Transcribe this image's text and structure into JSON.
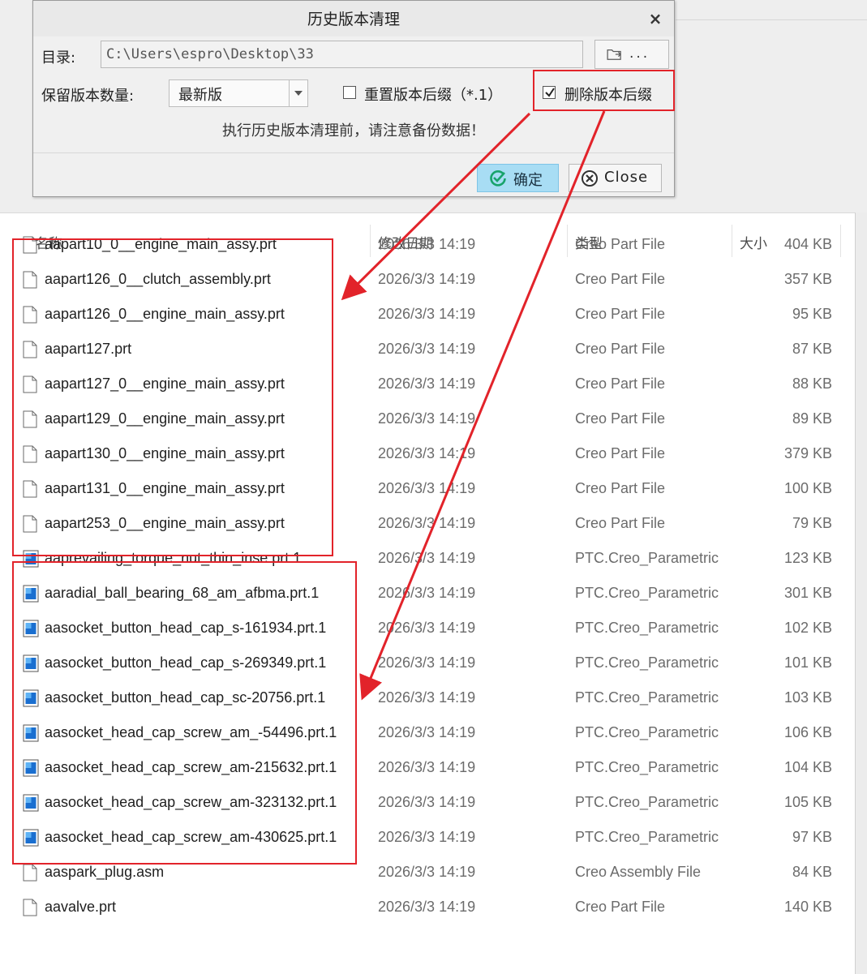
{
  "dialog": {
    "title": "历史版本清理",
    "close_glyph": "×",
    "dir_label": "目录:",
    "dir_value": "C:\\Users\\espro\\Desktop\\33",
    "browse_label": "...",
    "keep_label": "保留版本数量:",
    "keep_value": "最新版",
    "reset_suffix_label": "重置版本后缀（*.1）",
    "reset_suffix_checked": false,
    "delete_suffix_label": "删除版本后缀",
    "delete_suffix_checked": true,
    "warning": "执行历史版本清理前，请注意备份数据！",
    "ok_label": "确定",
    "close_label": "Close"
  },
  "explorer": {
    "columns": {
      "name": "名称",
      "date": "修改日期",
      "type": "类型",
      "size": "大小"
    },
    "files": [
      {
        "name": "aapart10_0__engine_main_assy.prt",
        "date": "2026/3/3 14:19",
        "type": "Creo Part File",
        "size": "404 KB",
        "icon": "blank-file-icon"
      },
      {
        "name": "aapart126_0__clutch_assembly.prt",
        "date": "2026/3/3 14:19",
        "type": "Creo Part File",
        "size": "357 KB",
        "icon": "blank-file-icon"
      },
      {
        "name": "aapart126_0__engine_main_assy.prt",
        "date": "2026/3/3 14:19",
        "type": "Creo Part File",
        "size": "95 KB",
        "icon": "blank-file-icon"
      },
      {
        "name": "aapart127.prt",
        "date": "2026/3/3 14:19",
        "type": "Creo Part File",
        "size": "87 KB",
        "icon": "blank-file-icon"
      },
      {
        "name": "aapart127_0__engine_main_assy.prt",
        "date": "2026/3/3 14:19",
        "type": "Creo Part File",
        "size": "88 KB",
        "icon": "blank-file-icon"
      },
      {
        "name": "aapart129_0__engine_main_assy.prt",
        "date": "2026/3/3 14:19",
        "type": "Creo Part File",
        "size": "89 KB",
        "icon": "blank-file-icon"
      },
      {
        "name": "aapart130_0__engine_main_assy.prt",
        "date": "2026/3/3 14:19",
        "type": "Creo Part File",
        "size": "379 KB",
        "icon": "blank-file-icon"
      },
      {
        "name": "aapart131_0__engine_main_assy.prt",
        "date": "2026/3/3 14:19",
        "type": "Creo Part File",
        "size": "100 KB",
        "icon": "blank-file-icon"
      },
      {
        "name": "aapart253_0__engine_main_assy.prt",
        "date": "2026/3/3 14:19",
        "type": "Creo Part File",
        "size": "79 KB",
        "icon": "blank-file-icon"
      },
      {
        "name": "aaprevailing_torque_nut_thin_inse.prt.1",
        "date": "2026/3/3 14:19",
        "type": "PTC.Creo_Parametric",
        "size": "123 KB",
        "icon": "creo-file-icon"
      },
      {
        "name": "aaradial_ball_bearing_68_am_afbma.prt.1",
        "date": "2026/3/3 14:19",
        "type": "PTC.Creo_Parametric",
        "size": "301 KB",
        "icon": "creo-file-icon"
      },
      {
        "name": "aasocket_button_head_cap_s-161934.prt.1",
        "date": "2026/3/3 14:19",
        "type": "PTC.Creo_Parametric",
        "size": "102 KB",
        "icon": "creo-file-icon"
      },
      {
        "name": "aasocket_button_head_cap_s-269349.prt.1",
        "date": "2026/3/3 14:19",
        "type": "PTC.Creo_Parametric",
        "size": "101 KB",
        "icon": "creo-file-icon"
      },
      {
        "name": "aasocket_button_head_cap_sc-20756.prt.1",
        "date": "2026/3/3 14:19",
        "type": "PTC.Creo_Parametric",
        "size": "103 KB",
        "icon": "creo-file-icon"
      },
      {
        "name": "aasocket_head_cap_screw_am_-54496.prt.1",
        "date": "2026/3/3 14:19",
        "type": "PTC.Creo_Parametric",
        "size": "106 KB",
        "icon": "creo-file-icon"
      },
      {
        "name": "aasocket_head_cap_screw_am-215632.prt.1",
        "date": "2026/3/3 14:19",
        "type": "PTC.Creo_Parametric",
        "size": "104 KB",
        "icon": "creo-file-icon"
      },
      {
        "name": "aasocket_head_cap_screw_am-323132.prt.1",
        "date": "2026/3/3 14:19",
        "type": "PTC.Creo_Parametric",
        "size": "105 KB",
        "icon": "creo-file-icon"
      },
      {
        "name": "aasocket_head_cap_screw_am-430625.prt.1",
        "date": "2026/3/3 14:19",
        "type": "PTC.Creo_Parametric",
        "size": "97 KB",
        "icon": "creo-file-icon"
      },
      {
        "name": "aaspark_plug.asm",
        "date": "2026/3/3 14:19",
        "type": "Creo Assembly File",
        "size": "84 KB",
        "icon": "blank-file-icon"
      },
      {
        "name": "aavalve.prt",
        "date": "2026/3/3 14:19",
        "type": "Creo Part File",
        "size": "140 KB",
        "icon": "blank-file-icon"
      }
    ]
  },
  "colors": {
    "annotation_red": "#e2232a",
    "ok_button": "#a8ddf4",
    "creo_blue": "#1a6fd0"
  }
}
